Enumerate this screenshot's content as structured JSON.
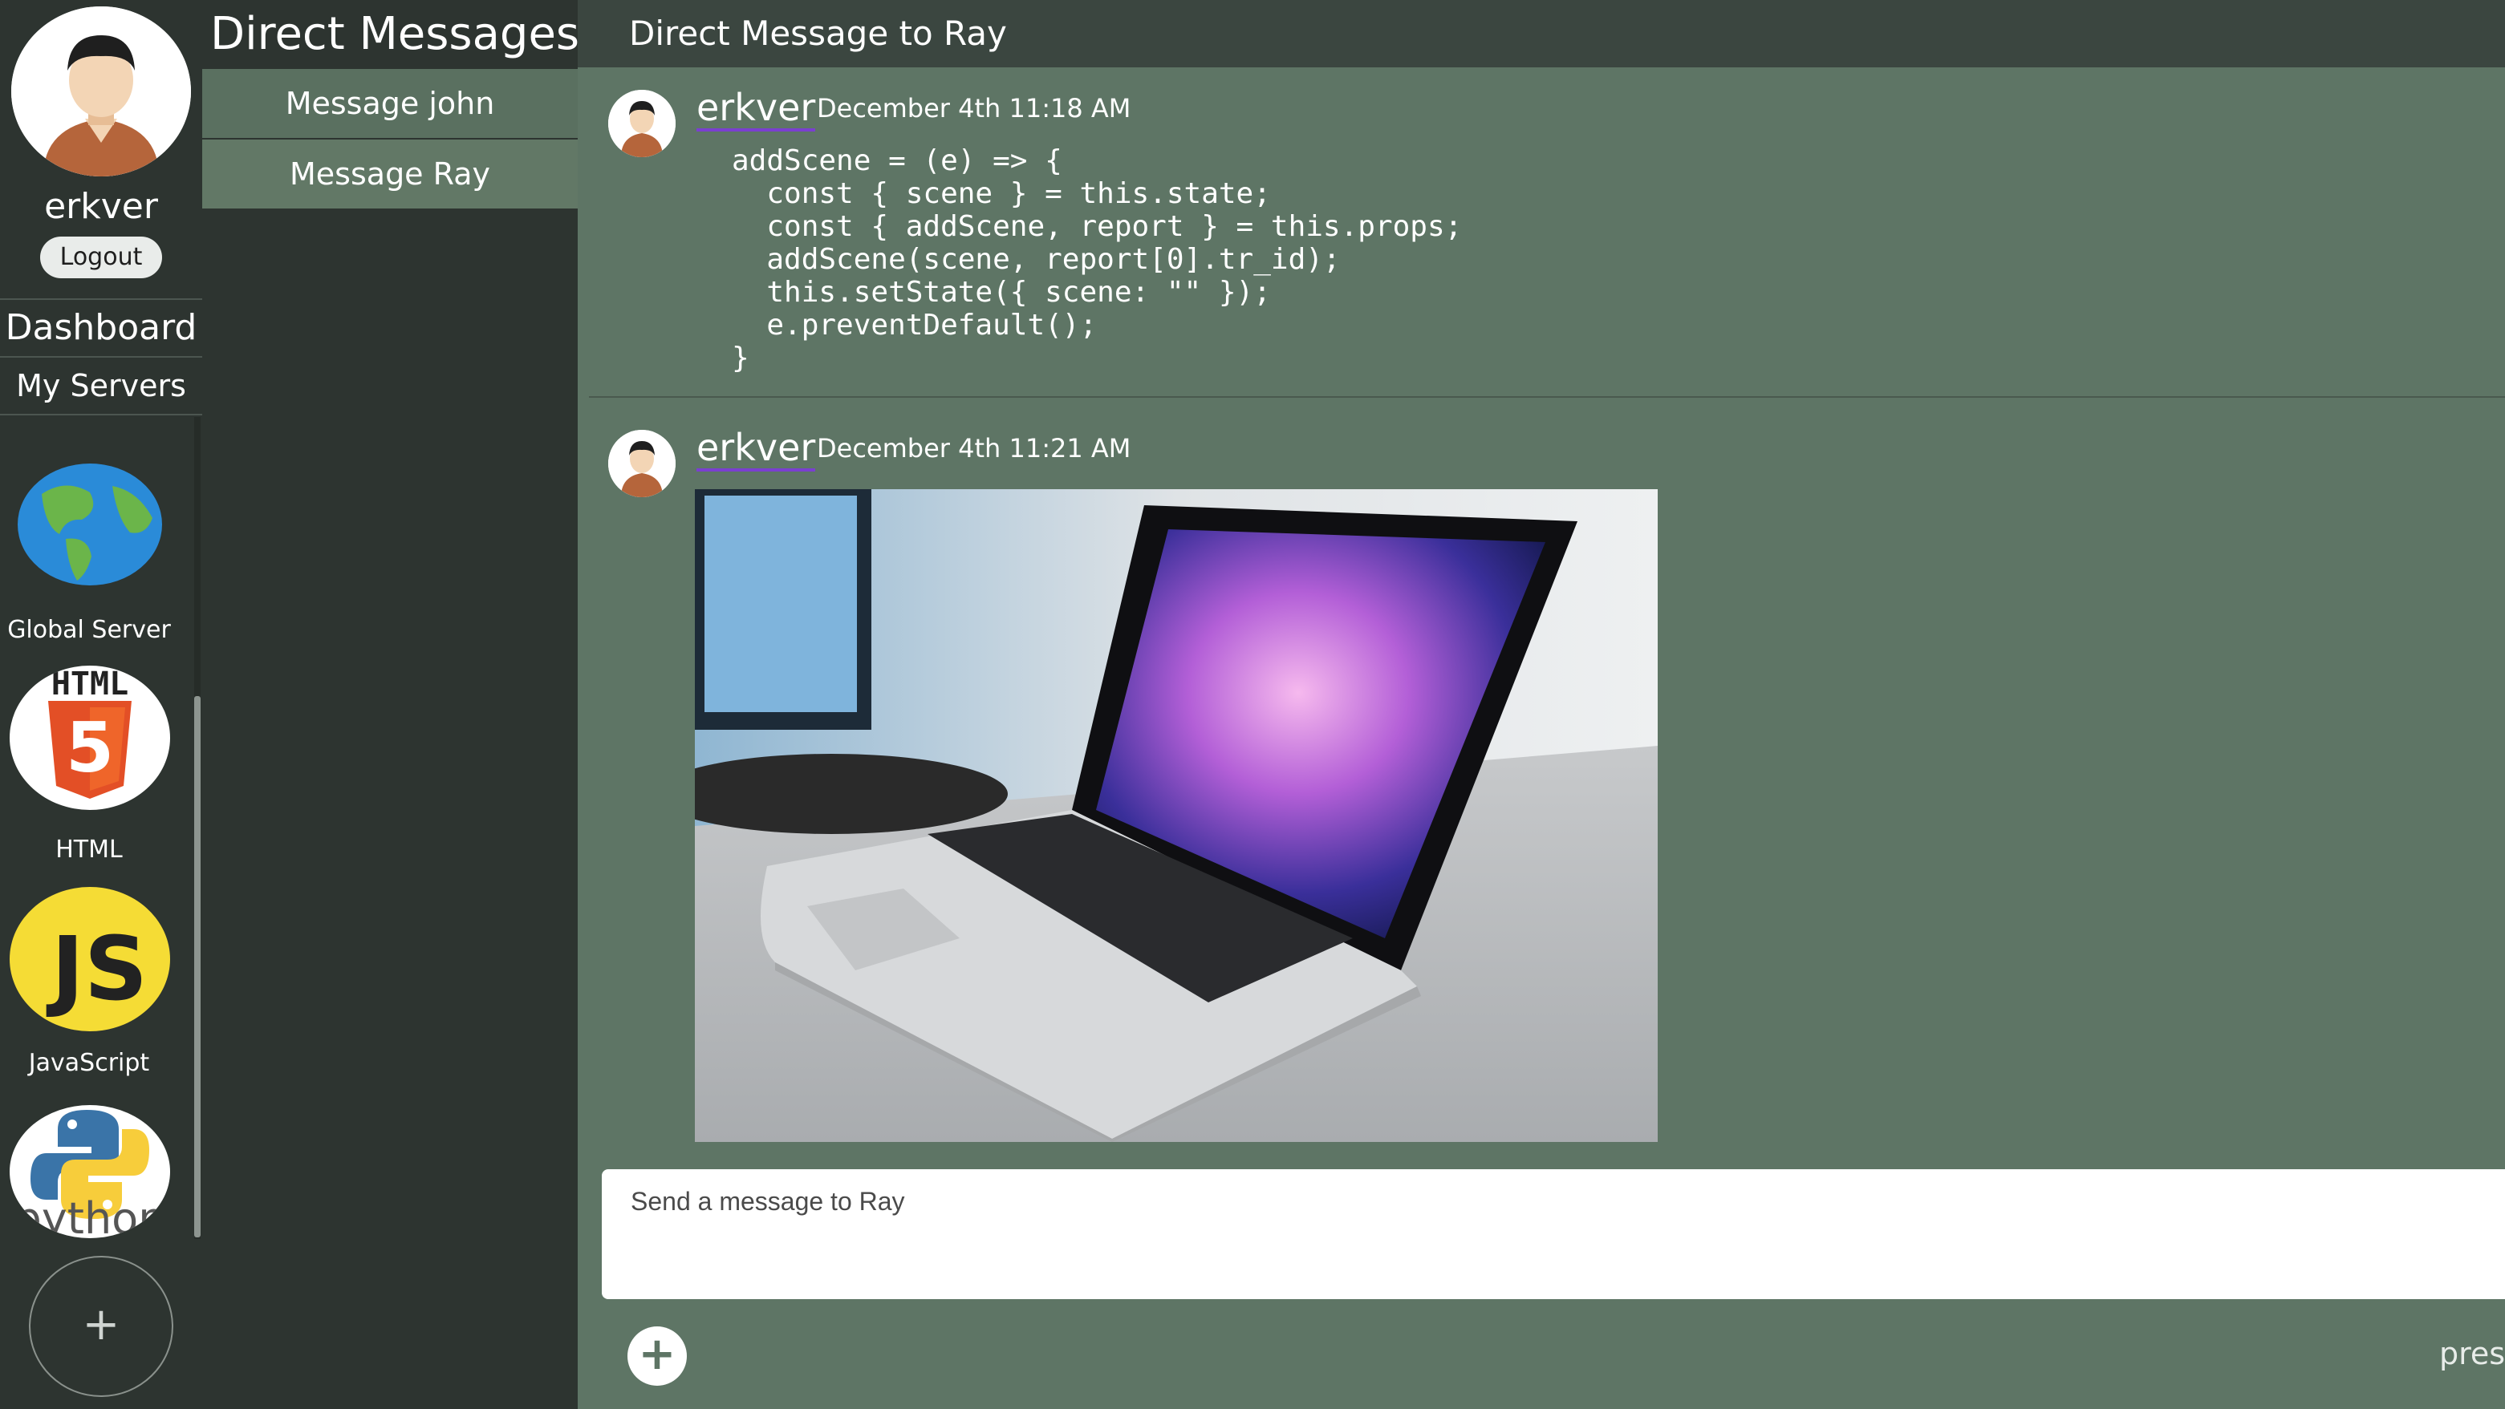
{
  "user": {
    "name": "erkver",
    "logout_label": "Logout"
  },
  "nav": {
    "dashboard": "Dashboard",
    "my_servers": "My Servers"
  },
  "servers": [
    {
      "label": "Global Server",
      "icon": "globe-icon"
    },
    {
      "label": "HTML",
      "icon": "html5-icon",
      "icon_text": "HTML",
      "badge": "5"
    },
    {
      "label": "JavaScript",
      "icon": "javascript-icon",
      "icon_text": "JS"
    },
    {
      "label": "",
      "icon": "python-icon",
      "icon_text": "python"
    }
  ],
  "add_server_label": "+",
  "direct_messages": {
    "title": "Direct Messages",
    "items": [
      {
        "label": "Message john"
      },
      {
        "label": "Message Ray"
      }
    ],
    "selected": "Message Ray"
  },
  "chat": {
    "title": "Direct Message to Ray",
    "messages": [
      {
        "author": "erkver",
        "time": "December 4th 11:18 AM",
        "code": "addScene = (e) => {\n  const { scene } = this.state;\n  const { addScene, report } = this.props;\n  addScene(scene, report[0].tr_id);\n  this.setState({ scene: \"\" });\n  e.preventDefault();\n}"
      },
      {
        "author": "erkver",
        "time": "December 4th 11:21 AM",
        "image": "laptop-photo"
      }
    ],
    "input_placeholder": "Send a message to Ray",
    "attach_label": "+",
    "hint_partial": "pres"
  },
  "colors": {
    "background": "#5e7565",
    "sidebar": "#2d3430",
    "header": "#3b4640",
    "username_underline": "#7a3fd0"
  }
}
